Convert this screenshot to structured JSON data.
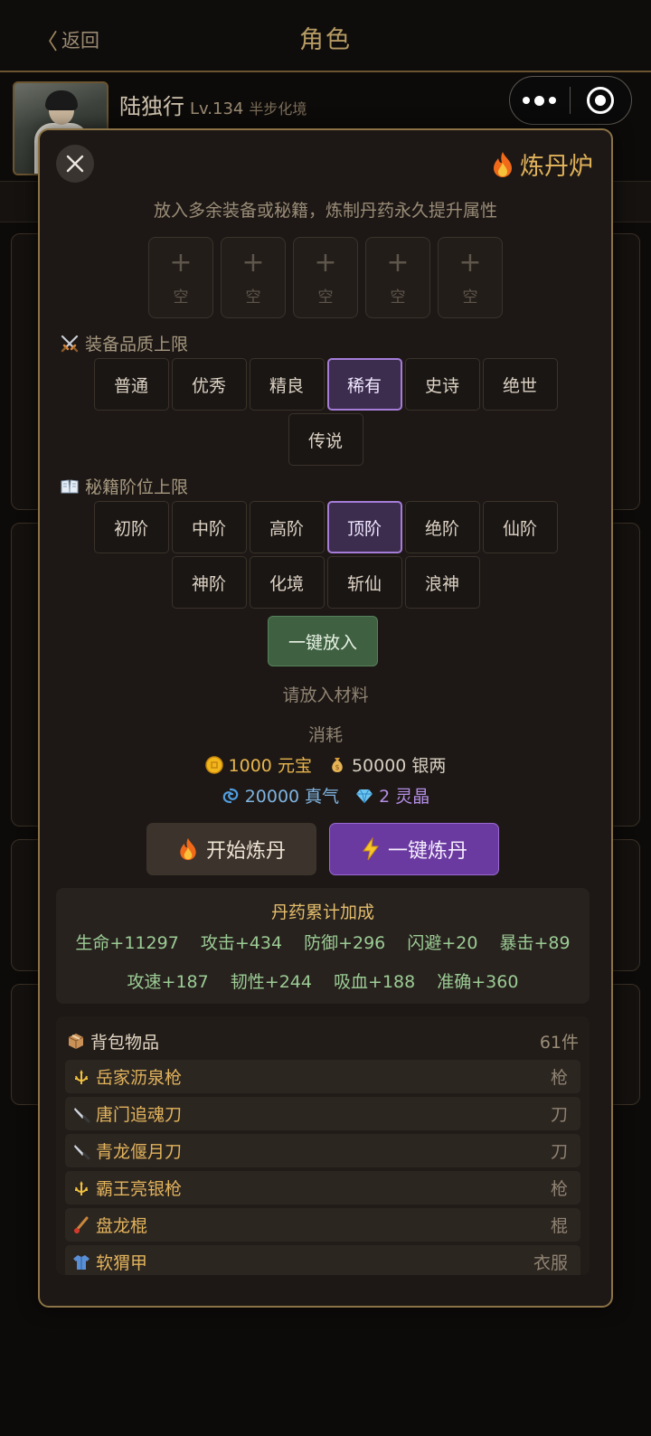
{
  "topbar": {
    "back_label": "返回",
    "title": "角色"
  },
  "hero": {
    "name": "陆独行",
    "level": "Lv.134",
    "realm": "半步化境"
  },
  "modal": {
    "title": "炼丹炉",
    "intro": "放入多余装备或秘籍，炼制丹药永久提升属性",
    "slots": [
      {
        "plus": "+",
        "label": "空"
      },
      {
        "plus": "+",
        "label": "空"
      },
      {
        "plus": "+",
        "label": "空"
      },
      {
        "plus": "+",
        "label": "空"
      },
      {
        "plus": "+",
        "label": "空"
      }
    ],
    "quality_section": {
      "label": "装备品质上限",
      "options": [
        "普通",
        "优秀",
        "精良",
        "稀有",
        "史诗",
        "绝世",
        "传说"
      ],
      "selected": "稀有"
    },
    "manual_section": {
      "label": "秘籍阶位上限",
      "options": [
        "初阶",
        "中阶",
        "高阶",
        "顶阶",
        "绝阶",
        "仙阶",
        "神阶",
        "化境",
        "斩仙",
        "浪神"
      ],
      "selected": "顶阶"
    },
    "put_button": "一键放入",
    "status": "请放入材料",
    "cost": {
      "label": "消耗",
      "yuanbao": "1000 元宝",
      "silver": "50000 银两",
      "qi": "20000 真气",
      "crystal": "2 灵晶"
    },
    "start_button": "开始炼丹",
    "quick_button": "一键炼丹",
    "bonus": {
      "title": "丹药累计加成",
      "line1": [
        "生命+11297",
        "攻击+434",
        "防御+296",
        "闪避+20",
        "暴击+89"
      ],
      "line2": [
        "攻速+187",
        "韧性+244",
        "吸血+188",
        "准确+360"
      ]
    },
    "bag": {
      "title": "背包物品",
      "count": "61件",
      "items": [
        {
          "name": "岳家沥泉枪",
          "kind": "枪",
          "icon": "spear-icon"
        },
        {
          "name": "唐门追魂刀",
          "kind": "刀",
          "icon": "knife-icon"
        },
        {
          "name": "青龙偃月刀",
          "kind": "刀",
          "icon": "knife-icon"
        },
        {
          "name": "霸王亮银枪",
          "kind": "枪",
          "icon": "spear-icon"
        },
        {
          "name": "盘龙棍",
          "kind": "棍",
          "icon": "staff-icon"
        },
        {
          "name": "软猬甲",
          "kind": "衣服",
          "icon": "armor-icon"
        }
      ]
    }
  },
  "colors": {
    "accent_gold": "#e0b25a",
    "selected_purple": "#a57dd8",
    "put_green": "#3f6142",
    "quick_purple": "#6a3aa0",
    "bonus_green": "#9ccc95"
  }
}
